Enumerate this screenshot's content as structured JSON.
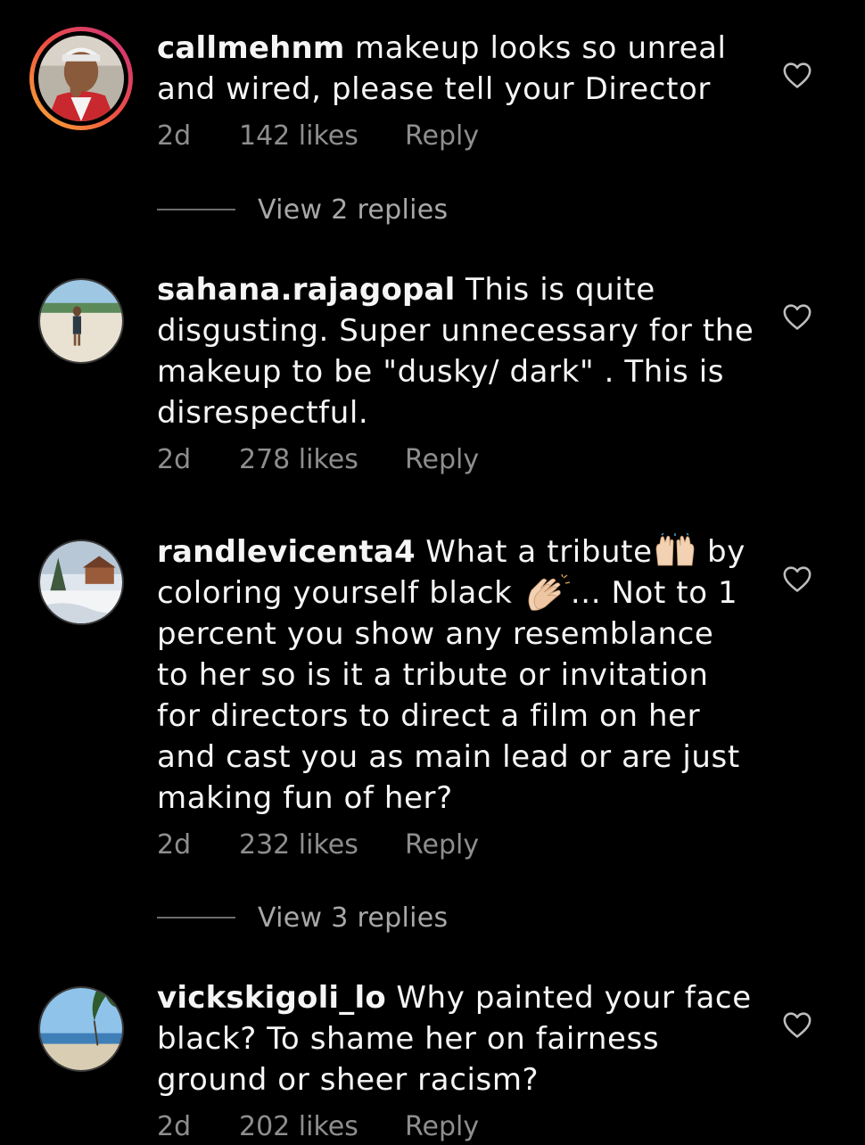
{
  "colors": {
    "background": "#000000",
    "text": "#f5f5f5",
    "meta": "#8e8e8e",
    "story_ring": [
      "#f9b233",
      "#ef4e43",
      "#c9307e"
    ]
  },
  "comments": [
    {
      "username": "callmehnm",
      "text": "makeup looks so unreal and wired, please tell your Director",
      "time": "2d",
      "likes": "142 likes",
      "reply": "Reply",
      "avatar_icon": "avatar-callmehnm-icon",
      "has_story_ring": true,
      "view_replies": "View 2 replies"
    },
    {
      "username": "sahana.rajagopal",
      "text": "This is quite disgusting. Super unnecessary for the makeup to be \"dusky/ dark\" . This is disrespectful.",
      "time": "2d",
      "likes": "278 likes",
      "reply": "Reply",
      "avatar_icon": "avatar-sahana-icon",
      "has_story_ring": false
    },
    {
      "username": "randlevicenta4",
      "text_part1": "What a tribute",
      "emoji1": "raising-hands-emoji",
      "text_part2": " by coloring yourself black ",
      "emoji2": "clapping-hands-emoji",
      "text_part3": "... Not to 1 percent you show any resemblance to her so is it a tribute or invitation for directors to direct a film on her and cast you as main lead or are just making fun of her?",
      "time": "2d",
      "likes": "232 likes",
      "reply": "Reply",
      "avatar_icon": "avatar-randlevicenta4-icon",
      "has_story_ring": false,
      "view_replies": "View 3 replies"
    },
    {
      "username": "vickskigoli_lo",
      "text": "Why painted your face black? To shame her on fairness ground or sheer racism?",
      "time": "2d",
      "likes": "202 likes",
      "reply": "Reply",
      "avatar_icon": "avatar-vickskigoli-icon",
      "has_story_ring": false
    }
  ],
  "icons": {
    "like": "heart-outline-icon"
  }
}
